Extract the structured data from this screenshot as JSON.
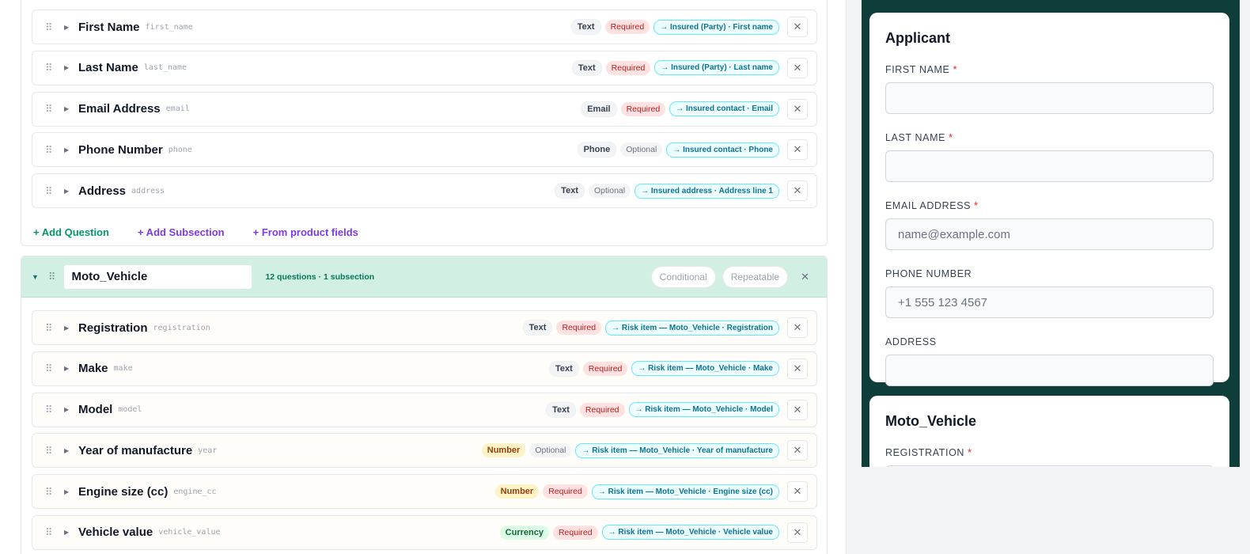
{
  "section_a": {
    "questions": [
      {
        "label": "First Name",
        "key": "first_name",
        "type": "Text",
        "status": "Required",
        "mapping": "→ Insured (Party) · First name"
      },
      {
        "label": "Last Name",
        "key": "last_name",
        "type": "Text",
        "status": "Required",
        "mapping": "→ Insured (Party) · Last name"
      },
      {
        "label": "Email Address",
        "key": "email",
        "type": "Email",
        "status": "Required",
        "mapping": "→ Insured contact · Email"
      },
      {
        "label": "Phone Number",
        "key": "phone",
        "type": "Phone",
        "status": "Optional",
        "mapping": "→ Insured contact · Phone"
      },
      {
        "label": "Address",
        "key": "address",
        "type": "Text",
        "status": "Optional",
        "mapping": "→ Insured address · Address line 1"
      }
    ],
    "actions": {
      "add_question": "+ Add Question",
      "add_subsection": "+ Add Subsection",
      "from_product": "+ From product fields"
    }
  },
  "section_b": {
    "name": "Moto_Vehicle",
    "meta": "12 questions · 1 subsection",
    "conditional_label": "Conditional",
    "repeatable_label": "Repeatable",
    "questions": [
      {
        "label": "Registration",
        "key": "registration",
        "type": "Text",
        "status": "Required",
        "mapping": "→ Risk item — Moto_Vehicle · Registration"
      },
      {
        "label": "Make",
        "key": "make",
        "type": "Text",
        "status": "Required",
        "mapping": "→ Risk item — Moto_Vehicle · Make"
      },
      {
        "label": "Model",
        "key": "model",
        "type": "Text",
        "status": "Required",
        "mapping": "→ Risk item — Moto_Vehicle · Model"
      },
      {
        "label": "Year of manufacture",
        "key": "year",
        "type": "Number",
        "status": "Optional",
        "mapping": "→ Risk item — Moto_Vehicle · Year of manufacture"
      },
      {
        "label": "Engine size (cc)",
        "key": "engine_cc",
        "type": "Number",
        "status": "Required",
        "mapping": "→ Risk item — Moto_Vehicle · Engine size (cc)"
      },
      {
        "label": "Vehicle value",
        "key": "vehicle_value",
        "type": "Currency",
        "status": "Required",
        "mapping": "→ Risk item — Moto_Vehicle · Vehicle value"
      }
    ]
  },
  "preview": {
    "card1": {
      "title": "Applicant",
      "fields": [
        {
          "label": "FIRST NAME",
          "required": "*",
          "placeholder": ""
        },
        {
          "label": "LAST NAME",
          "required": "*",
          "placeholder": ""
        },
        {
          "label": "EMAIL ADDRESS",
          "required": "*",
          "placeholder": "name@example.com"
        },
        {
          "label": "PHONE NUMBER",
          "required": "",
          "placeholder": "+1 555 123 4567"
        },
        {
          "label": "ADDRESS",
          "required": "",
          "placeholder": ""
        }
      ]
    },
    "card2": {
      "title": "Moto_Vehicle",
      "fields": [
        {
          "label": "REGISTRATION",
          "required": "*",
          "placeholder": ""
        }
      ]
    }
  },
  "colors": {
    "accent": "#7c3aed",
    "section_header": "#d1efe3",
    "preview_bg": "#0f3d3a",
    "required": "#b91c1c",
    "mapping": "#0e7490"
  }
}
